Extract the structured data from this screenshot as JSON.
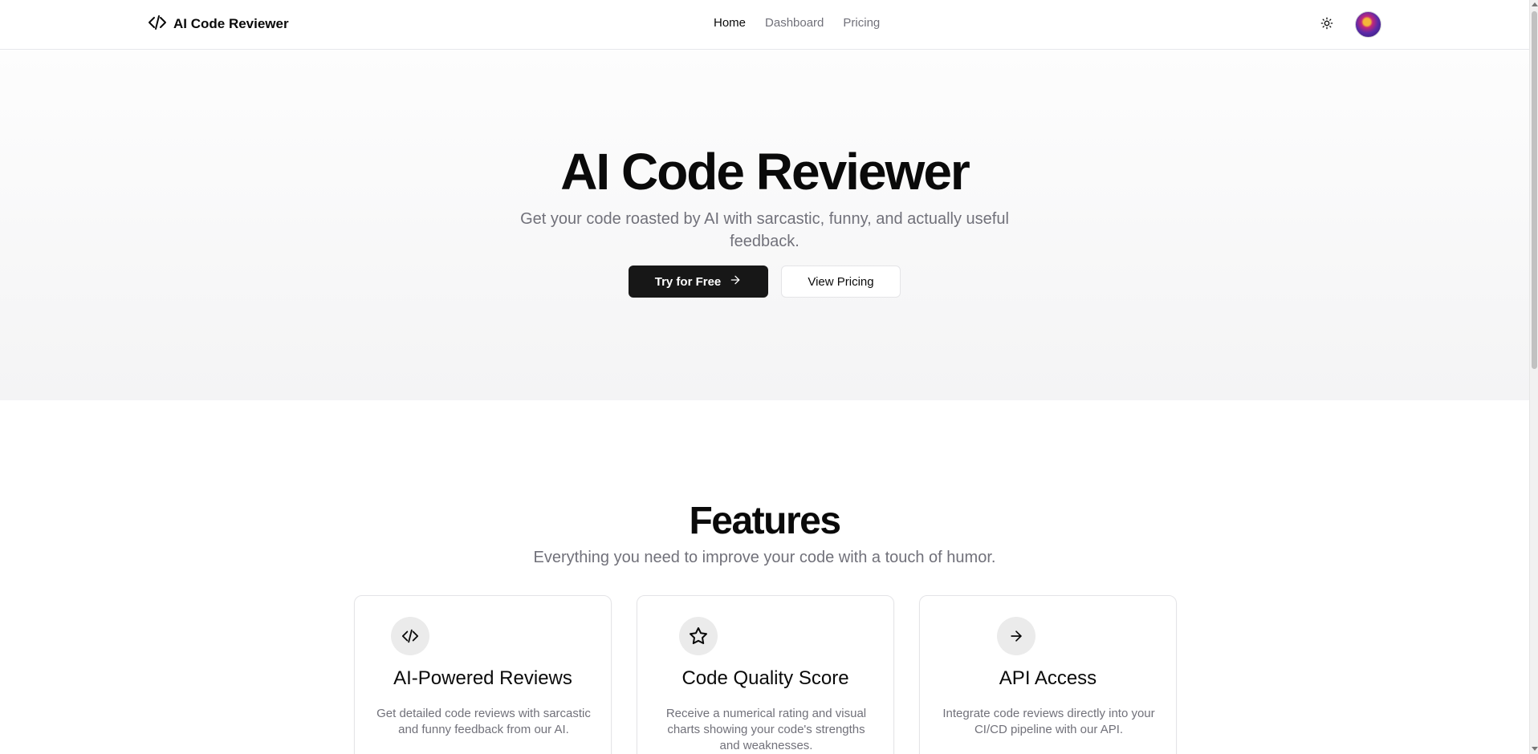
{
  "header": {
    "brand": "AI Code Reviewer",
    "brand_icon": "code-icon",
    "nav": [
      {
        "label": "Home",
        "active": true
      },
      {
        "label": "Dashboard",
        "active": false
      },
      {
        "label": "Pricing",
        "active": false
      }
    ],
    "theme_icon": "sun-icon"
  },
  "hero": {
    "title": "AI Code Reviewer",
    "subtitle": "Get your code roasted by AI with sarcastic, funny, and actually useful feedback.",
    "primary_button": "Try for Free",
    "secondary_button": "View Pricing"
  },
  "features": {
    "title": "Features",
    "subtitle": "Everything you need to improve your code with a touch of humor.",
    "cards": [
      {
        "icon": "code-icon",
        "title": "AI-Powered Reviews",
        "description": "Get detailed code reviews with sarcastic and funny feedback from our AI."
      },
      {
        "icon": "star-icon",
        "title": "Code Quality Score",
        "description": "Receive a numerical rating and visual charts showing your code's strengths and weaknesses."
      },
      {
        "icon": "arrow-right-icon",
        "title": "API Access",
        "description": "Integrate code reviews directly into your CI/CD pipeline with our API."
      }
    ]
  },
  "colors": {
    "primary": "#171717",
    "muted_text": "#71717a",
    "border": "#e4e4e7"
  }
}
